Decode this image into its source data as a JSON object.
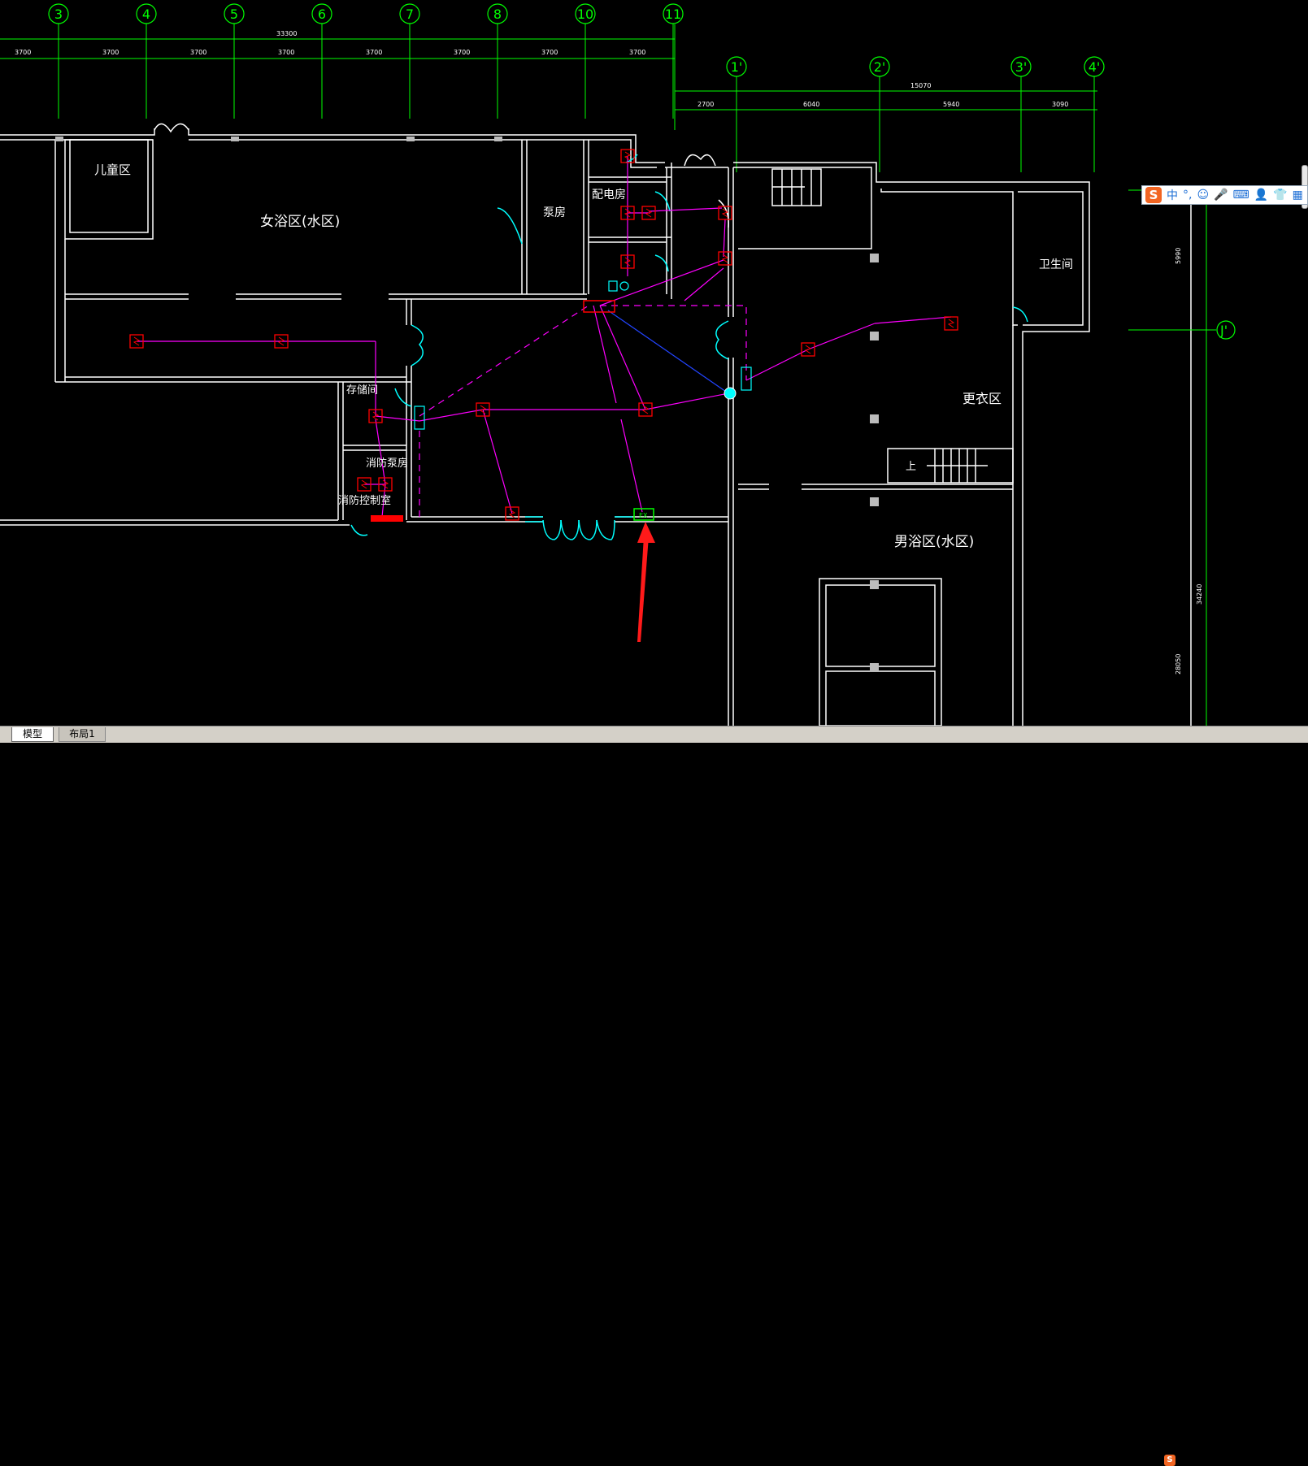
{
  "drawing": {
    "axes_top": [
      "3",
      "4",
      "5",
      "6",
      "7",
      "8",
      "10",
      "11"
    ],
    "axes_right_top": [
      "1'",
      "2'",
      "3'",
      "4'"
    ],
    "axis_right_side": "J'",
    "dim_total_top": "33300",
    "dim_spans_top": [
      "3700",
      "3700",
      "3700",
      "3700",
      "3700",
      "3700",
      "3700",
      "3700"
    ],
    "dim_total_right": "15070",
    "dim_spans_right": [
      "2700",
      "6040",
      "5940",
      "3090"
    ],
    "dim_vertical": [
      "5990",
      "34240",
      "28050"
    ],
    "rooms": {
      "children_area": "儿童区",
      "women_bath": "女浴区(水区)",
      "pump_room": "泵房",
      "power_room": "配电房",
      "storage": "存储间",
      "fire_pump": "消防泵房",
      "fire_control": "消防控制室",
      "toilet": "卫生间",
      "changing": "更衣区",
      "men_bath": "男浴区(水区)",
      "stair_up": "上"
    },
    "device_label": "EX"
  },
  "tabs": [
    {
      "label": "模型",
      "active": true
    },
    {
      "label": "布局1",
      "active": false
    }
  ],
  "ime": {
    "logo": "S",
    "mode": "中",
    "punct": "°,",
    "emoji": "☺",
    "voice": "🎤",
    "keyboard": "⌨",
    "user": "👤",
    "skin": "👕",
    "tools": "▦"
  },
  "tray": {
    "logo": "S",
    "arrow": "⇕"
  },
  "colors": {
    "axis": "#00ff00",
    "wall": "#ffffff",
    "wire": "#ff00ff",
    "device": "#ff0000",
    "door": "#00ffff",
    "arrow": "#ff1a1a"
  }
}
